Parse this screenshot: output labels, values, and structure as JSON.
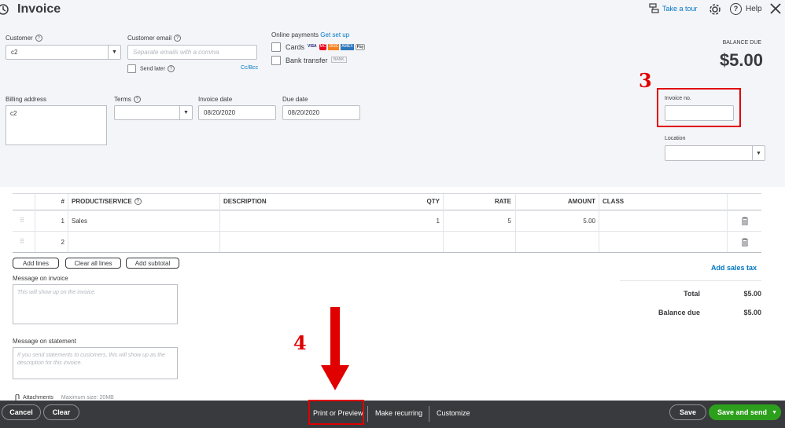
{
  "header": {
    "title": "Invoice",
    "take_tour": "Take a tour",
    "help": "Help"
  },
  "customer": {
    "label": "Customer",
    "value": "c2"
  },
  "customer_email": {
    "label": "Customer email",
    "placeholder": "Separate emails with a comma",
    "send_later": "Send later",
    "cc_bcc": "Cc/Bcc"
  },
  "online_payments": {
    "label": "Online payments",
    "get_set_up": "Get set up",
    "cards": "Cards",
    "bank_transfer": "Bank transfer",
    "card_brands": [
      "VISA",
      "MC",
      "DISC",
      "AMEX",
      "Pay"
    ],
    "bank_badge": "BANK"
  },
  "balance": {
    "label": "BALANCE DUE",
    "amount": "$5.00"
  },
  "billing": {
    "label": "Billing address",
    "value": "c2"
  },
  "terms": {
    "label": "Terms"
  },
  "invoice_date": {
    "label": "Invoice date",
    "value": "08/20/2020"
  },
  "due_date": {
    "label": "Due date",
    "value": "08/20/2020"
  },
  "invoice_no": {
    "label": "Invoice no.",
    "value": ""
  },
  "location": {
    "label": "Location"
  },
  "annotations": {
    "step3": "3",
    "step4": "4"
  },
  "table": {
    "headers": [
      "#",
      "PRODUCT/SERVICE",
      "DESCRIPTION",
      "QTY",
      "RATE",
      "AMOUNT",
      "CLASS"
    ],
    "rows": [
      {
        "num": "1",
        "product": "Sales",
        "description": "",
        "qty": "1",
        "rate": "5",
        "amount": "5.00",
        "class": ""
      },
      {
        "num": "2",
        "product": "",
        "description": "",
        "qty": "",
        "rate": "",
        "amount": "",
        "class": ""
      }
    ]
  },
  "table_actions": {
    "add_lines": "Add lines",
    "clear_all_lines": "Clear all lines",
    "add_subtotal": "Add subtotal"
  },
  "message_invoice": {
    "label": "Message on invoice",
    "placeholder": "This will show up on the invoice."
  },
  "message_statement": {
    "label": "Message on statement",
    "placeholder": "If you send statements to customers, this will show up as the description for this invoice."
  },
  "attachments": {
    "label": "Attachments",
    "max_size": "Maximum size: 20MB"
  },
  "totals": {
    "add_sales_tax": "Add sales tax",
    "total_label": "Total",
    "total_value": "$5.00",
    "balance_due_label": "Balance due",
    "balance_due_value": "$5.00"
  },
  "footer": {
    "cancel": "Cancel",
    "clear": "Clear",
    "print_preview": "Print or Preview",
    "make_recurring": "Make recurring",
    "customize": "Customize",
    "save": "Save",
    "save_and_send": "Save and send"
  },
  "colors": {
    "accent_green": "#2ca01c",
    "link_blue": "#0077c5",
    "annotation_red": "#e00000",
    "footer_bg": "#393a3d"
  }
}
